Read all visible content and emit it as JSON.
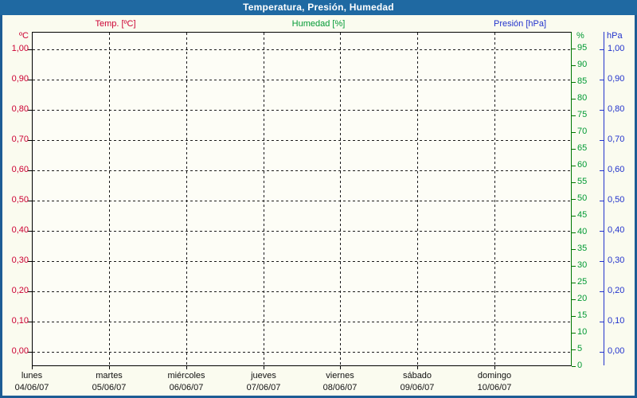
{
  "window": {
    "title": "Temperatura, Presión, Humedad"
  },
  "legend": {
    "items": [
      {
        "id": "temperature",
        "label": "Temp. [ºC]",
        "color": "#cc0033"
      },
      {
        "id": "humidity",
        "label": "Humedad [%]",
        "color": "#009933"
      },
      {
        "id": "pressure",
        "label": "Presión [hPa]",
        "color": "#2233cc"
      }
    ]
  },
  "axes": {
    "temperature": {
      "unit": "ºC",
      "color": "#cc0033",
      "ticks": [
        "1,00",
        "0,90",
        "0,80",
        "0,70",
        "0,60",
        "0,50",
        "0,40",
        "0,30",
        "0,20",
        "0,10",
        "0,00"
      ]
    },
    "pressure": {
      "unit": "hPa",
      "color": "#2233cc",
      "ticks": [
        "1,00",
        "0,90",
        "0,80",
        "0,70",
        "0,60",
        "0,50",
        "0,40",
        "0,30",
        "0,20",
        "0,10",
        "0,00"
      ]
    },
    "humidity": {
      "unit": "%",
      "color": "#009933",
      "line_color": "#007700",
      "tick_values": [
        95,
        90,
        85,
        80,
        75,
        70,
        65,
        60,
        55,
        50,
        45,
        40,
        35,
        30,
        25,
        20,
        15,
        10,
        5,
        0
      ]
    },
    "x": {
      "days": [
        {
          "name": "lunes",
          "date": "04/06/07"
        },
        {
          "name": "martes",
          "date": "05/06/07"
        },
        {
          "name": "miércoles",
          "date": "06/06/07"
        },
        {
          "name": "jueves",
          "date": "07/06/07"
        },
        {
          "name": "viernes",
          "date": "08/06/07"
        },
        {
          "name": "sábado",
          "date": "09/06/07"
        },
        {
          "name": "domingo",
          "date": "10/06/07"
        }
      ]
    }
  },
  "chart_data": {
    "type": "line",
    "title": "Temperatura, Presión, Humedad",
    "x_day_names": [
      "lunes",
      "martes",
      "miércoles",
      "jueves",
      "viernes",
      "sábado",
      "domingo"
    ],
    "x_categories": [
      "04/06/07",
      "05/06/07",
      "06/06/07",
      "07/06/07",
      "08/06/07",
      "09/06/07",
      "10/06/07"
    ],
    "series": [
      {
        "name": "Temp. [ºC]",
        "axis": "left-temperature",
        "color": "#cc0033",
        "values": []
      },
      {
        "name": "Humedad [%]",
        "axis": "right-humidity",
        "color": "#009933",
        "values": []
      },
      {
        "name": "Presión [hPa]",
        "axis": "right-pressure",
        "color": "#2233cc",
        "values": []
      }
    ],
    "axis_ranges": {
      "temperature": {
        "tick_min": "0,00",
        "tick_max": "1,00",
        "tick_step": "0,10"
      },
      "humidity": {
        "tick_min": 0,
        "tick_max": 95,
        "tick_step": 5
      },
      "pressure": {
        "tick_min": "0,00",
        "tick_max": "1,00",
        "tick_step": "0,10"
      }
    },
    "grid": true,
    "grid_style": "dashed",
    "legend_position": "top"
  }
}
